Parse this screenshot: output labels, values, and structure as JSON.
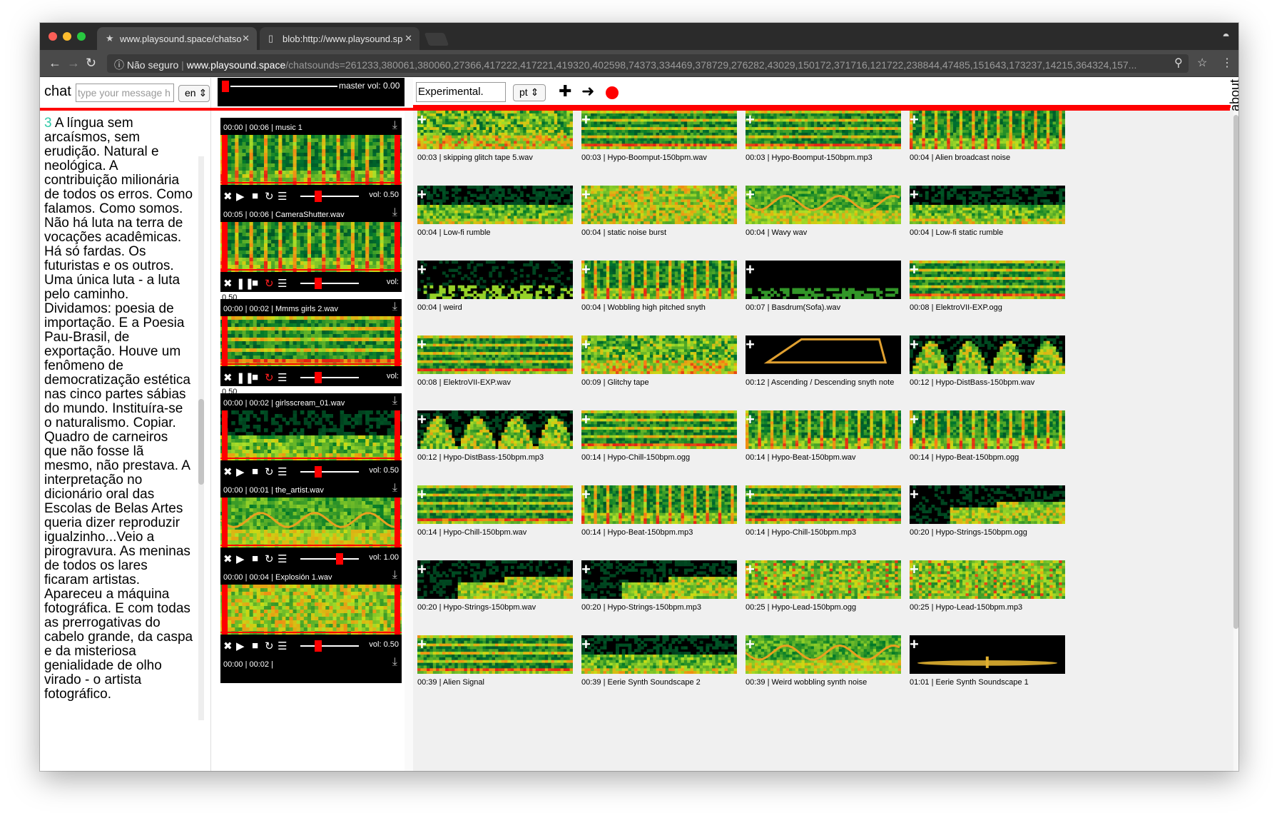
{
  "browser": {
    "tabs": [
      {
        "title": "www.playsound.space/chatso",
        "icon": "music-icon"
      },
      {
        "title": "blob:http://www.playsound.sp",
        "icon": "file-icon"
      }
    ],
    "security": "Não seguro",
    "url_host": "www.playsound.space",
    "url_rest": "/chatsounds=261233,380061,380060,27366,417222,417221,419320,402598,74373,334469,378729,276282,43029,150172,371716,121722,238844,47485,151643,173237,14215,364324,157..."
  },
  "chat": {
    "label": "chat",
    "input_placeholder": "type your message h",
    "lang": "en",
    "number": "3",
    "text": "A língua sem arcaísmos, sem erudição. Natural e neológica. A contribuição milionária de todos os erros. Como falamos. Como somos. Não há luta na terra de vocações acadêmicas. Há só fardas. Os futuristas e os outros. Uma única luta - a luta pelo caminho. Dividamos: poesia de importação. E a Poesia Pau-Brasil, de exportação. Houve um fenômeno de democratização estética nas cinco partes sábias do mundo. Instituíra-se o naturalismo. Copiar. Quadro de carneiros que não fosse lã mesmo, não prestava. A interpretação no dicionário oral das Escolas de Belas Artes queria dizer reproduzir igualzinho...Veio a pirogravura. As meninas de todos os lares ficaram artistas. Apareceu a máquina fotográfica. E com todas as prerrogativas do cabelo grande, da caspa e da misteriosa genialidade de olho virado - o artista fotográfico."
  },
  "master": {
    "label": "master vol: 0.00"
  },
  "players": [
    {
      "title": "00:00 | 00:06 | music 1",
      "vol": "vol: 0.50",
      "playing": false,
      "hue": "music"
    },
    {
      "title": "00:05 | 00:06 | CameraShutter.wav",
      "vol": "vol:",
      "vol2": "0.50",
      "playing": true,
      "hue": "shutter"
    },
    {
      "title": "00:00 | 00:02 | Mmms girls 2.wav",
      "vol": "vol:",
      "vol2": "0.50",
      "playing": true,
      "hue": "mmms"
    },
    {
      "title": "00:00 | 00:02 | girlsscream_01.wav",
      "vol": "vol: 0.50",
      "playing": false,
      "hue": "scream"
    },
    {
      "title": "00:00 | 00:01 | the_artist.wav",
      "vol": "vol: 1.00",
      "playing": false,
      "hue": "artist"
    },
    {
      "title": "00:00 | 00:04 | Explosión 1.wav",
      "vol": "vol: 0.50",
      "playing": false,
      "hue": "explosion"
    },
    {
      "title": "00:00 | 00:02 |",
      "vol": "",
      "playing": false,
      "hue": "last"
    }
  ],
  "library": {
    "search_value": "Experimental.",
    "lang": "pt",
    "about": "about",
    "items": [
      {
        "caption": "00:03 | skipping glitch tape 5.wav",
        "style": "glitch"
      },
      {
        "caption": "00:03 | Hypo-Boomput-150bpm.wav",
        "style": "lines"
      },
      {
        "caption": "00:03 | Hypo-Boomput-150bpm.mp3",
        "style": "lines"
      },
      {
        "caption": "00:04 | Alien broadcast noise",
        "style": "bars"
      },
      {
        "caption": "00:04 | Low-fi rumble",
        "style": "low"
      },
      {
        "caption": "00:04 | static noise burst",
        "style": "noise"
      },
      {
        "caption": "00:04 | Wavy wav",
        "style": "wavy"
      },
      {
        "caption": "00:04 | Low-fi static rumble",
        "style": "low"
      },
      {
        "caption": "00:04 | weird",
        "style": "sparse"
      },
      {
        "caption": "00:04 | Wobbling high pitched snyth",
        "style": "bars"
      },
      {
        "caption": "00:07 | Basdrum(Sofa).wav",
        "style": "dark"
      },
      {
        "caption": "00:08 | ElektroVII-EXP.ogg",
        "style": "lines"
      },
      {
        "caption": "00:08 | ElektroVII-EXP.wav",
        "style": "lines"
      },
      {
        "caption": "00:09 | Glitchy tape",
        "style": "glitch"
      },
      {
        "caption": "00:12 | Ascending / Descending snyth note",
        "style": "trapezoid"
      },
      {
        "caption": "00:12 | Hypo-DistBass-150bpm.wav",
        "style": "humps"
      },
      {
        "caption": "00:12 | Hypo-DistBass-150bpm.mp3",
        "style": "humps"
      },
      {
        "caption": "00:14 | Hypo-Chill-150bpm.ogg",
        "style": "lines"
      },
      {
        "caption": "00:14 | Hypo-Beat-150bpm.wav",
        "style": "bars"
      },
      {
        "caption": "00:14 | Hypo-Beat-150bpm.ogg",
        "style": "bars"
      },
      {
        "caption": "00:14 | Hypo-Chill-150bpm.wav",
        "style": "lines"
      },
      {
        "caption": "00:14 | Hypo-Beat-150bpm.mp3",
        "style": "bars"
      },
      {
        "caption": "00:14 | Hypo-Chill-150bpm.mp3",
        "style": "lines"
      },
      {
        "caption": "00:20 | Hypo-Strings-150bpm.ogg",
        "style": "steps"
      },
      {
        "caption": "00:20 | Hypo-Strings-150bpm.wav",
        "style": "steps"
      },
      {
        "caption": "00:20 | Hypo-Strings-150bpm.mp3",
        "style": "steps"
      },
      {
        "caption": "00:25 | Hypo-Lead-150bpm.ogg",
        "style": "diag"
      },
      {
        "caption": "00:25 | Hypo-Lead-150bpm.mp3",
        "style": "diag"
      },
      {
        "caption": "00:39 | Alien Signal",
        "style": "lines"
      },
      {
        "caption": "00:39 | Eerie Synth Soundscape 2",
        "style": "low"
      },
      {
        "caption": "00:39 | Weird wobbling synth noise",
        "style": "wavy"
      },
      {
        "caption": "01:01 | Eerie Synth Soundscape 1",
        "style": "ellipse"
      }
    ]
  }
}
